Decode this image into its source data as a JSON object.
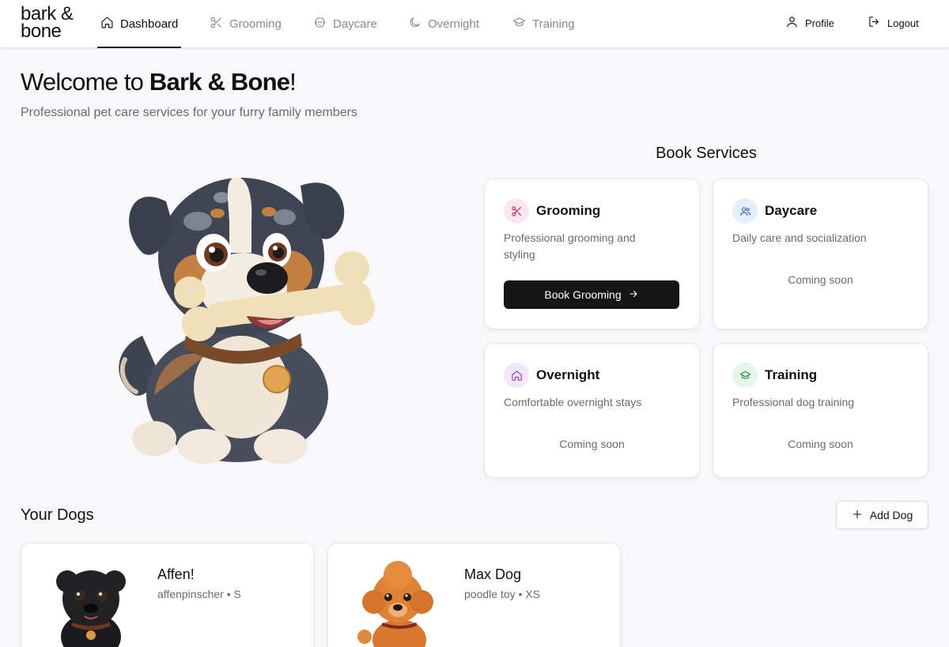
{
  "brand": {
    "line1": "bark &",
    "line2": "bone"
  },
  "nav": {
    "items": [
      {
        "label": "Dashboard",
        "icon": "home-icon",
        "active": true
      },
      {
        "label": "Grooming",
        "icon": "scissors-icon"
      },
      {
        "label": "Daycare",
        "icon": "dog-face-icon"
      },
      {
        "label": "Overnight",
        "icon": "moon-icon"
      },
      {
        "label": "Training",
        "icon": "graduation-cap-icon"
      }
    ],
    "profile_label": "Profile",
    "logout_label": "Logout"
  },
  "hero": {
    "welcome_prefix": "Welcome to ",
    "welcome_brand": "Bark & Bone",
    "welcome_suffix": "!",
    "subtitle": "Professional pet care services for your furry family members"
  },
  "services": {
    "title": "Book Services",
    "cards": [
      {
        "title": "Grooming",
        "description": "Professional grooming and styling",
        "button_label": "Book Grooming",
        "icon": "scissors-icon",
        "accent": "#c0185f",
        "icon_bg": "#fbe7f0"
      },
      {
        "title": "Daycare",
        "description": "Daily care and socialization",
        "status": "Coming soon",
        "icon": "users-icon",
        "accent": "#2f5fc4",
        "icon_bg": "#e6eefb"
      },
      {
        "title": "Overnight",
        "description": "Comfortable overnight stays",
        "status": "Coming soon",
        "icon": "home-icon",
        "accent": "#8a2bb8",
        "icon_bg": "#f2e6fb"
      },
      {
        "title": "Training",
        "description": "Professional dog training",
        "status": "Coming soon",
        "icon": "graduation-cap-icon",
        "accent": "#1f8a4c",
        "icon_bg": "#e4f6ea"
      }
    ]
  },
  "dogs": {
    "title": "Your Dogs",
    "add_label": "Add Dog",
    "list": [
      {
        "name": "Affen!",
        "breed": "affenpinscher",
        "size": "S"
      },
      {
        "name": "Max Dog",
        "breed": "poodle toy",
        "size": "XS"
      }
    ]
  },
  "separator": "•"
}
